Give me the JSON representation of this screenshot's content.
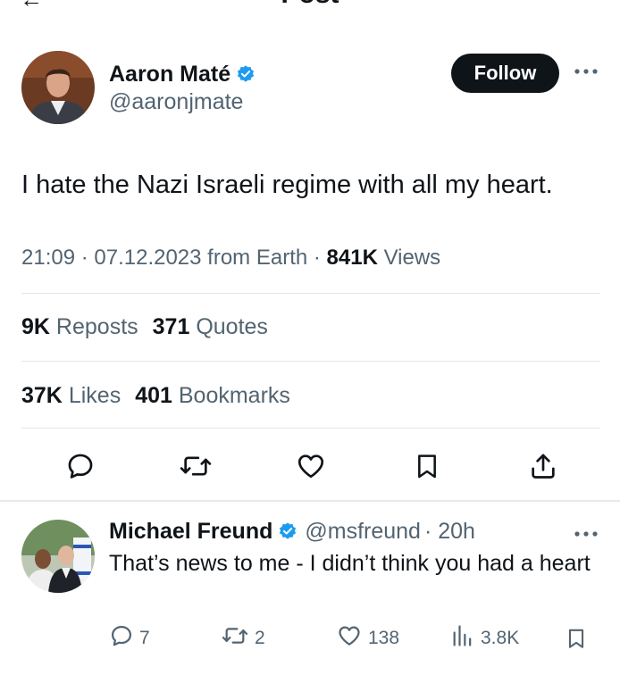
{
  "header": {
    "back_glyph": "←",
    "title": "Post"
  },
  "post": {
    "author": {
      "name": "Aaron Maté",
      "handle": "@aaronjmate"
    },
    "follow_label": "Follow",
    "more_glyph": "•••",
    "text": "I hate the Nazi Israeli regime with all my heart.",
    "meta": {
      "time_date_source": "21:09 · 07.12.2023 from Earth · ",
      "views_count": "841K",
      "views_label": "Views"
    },
    "stats": {
      "reposts_count": "9K",
      "reposts_label": "Reposts",
      "quotes_count": "371",
      "quotes_label": "Quotes",
      "likes_count": "37K",
      "likes_label": "Likes",
      "bookmarks_count": "401",
      "bookmarks_label": "Bookmarks"
    },
    "actions": [
      "reply-icon",
      "repost-icon",
      "like-icon",
      "bookmark-icon",
      "share-icon"
    ]
  },
  "reply": {
    "author": {
      "name": "Michael Freund",
      "handle": "@msfreund",
      "time": "· 20h"
    },
    "more_glyph": "•••",
    "text": "That’s news to me - I didn’t think you had a heart",
    "actions": {
      "replies": "7",
      "reposts": "2",
      "likes": "138",
      "views": "3.8K"
    }
  },
  "colors": {
    "text": "#0f1419",
    "secondary": "#536471",
    "verified": "#1d9bf0",
    "divider": "#e3e6ea"
  }
}
